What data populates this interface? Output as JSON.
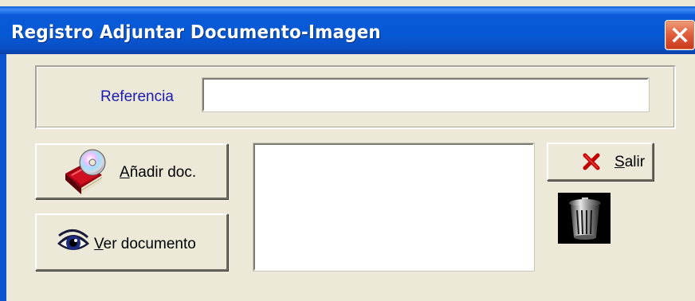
{
  "window": {
    "title": "Registro Adjuntar Documento-Imagen",
    "close_icon": "close-icon"
  },
  "form": {
    "reference_label": "Referencia",
    "reference_value": ""
  },
  "buttons": {
    "add_doc": {
      "prefix": "",
      "accel": "A",
      "rest": "ñadir doc.",
      "icon": "book-cd-icon"
    },
    "view_doc": {
      "prefix": "",
      "accel": "V",
      "rest": "er documento",
      "icon": "eye-icon"
    },
    "exit": {
      "prefix": "",
      "accel": "S",
      "rest": "alir",
      "icon": "red-x-icon"
    }
  },
  "list": {
    "items": []
  },
  "trash": {
    "icon": "trash-icon"
  },
  "colors": {
    "titlebar": "#0558d4",
    "face": "#ece9d8",
    "label_blue": "#1b1bb0",
    "close_red": "#e0613f"
  }
}
